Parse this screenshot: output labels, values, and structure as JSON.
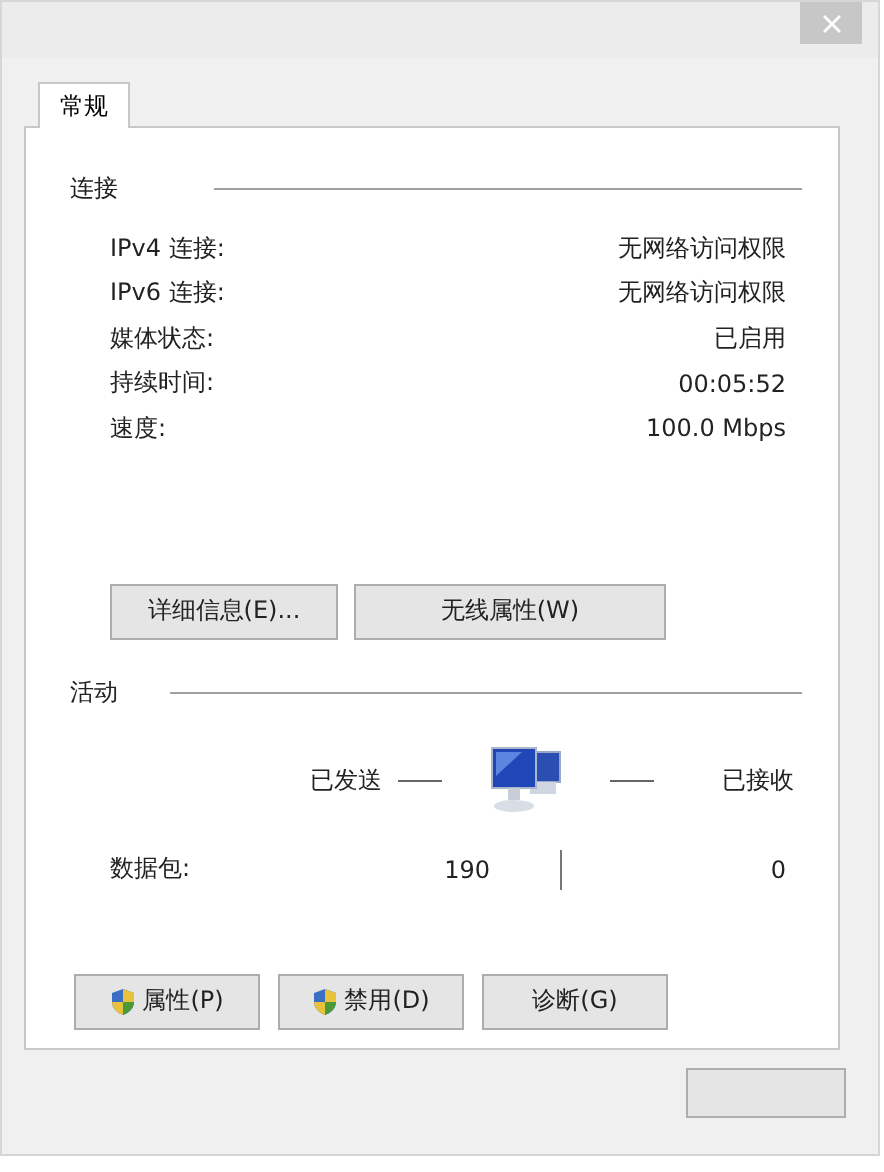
{
  "tabs": [
    {
      "label": "常规",
      "selected": true
    }
  ],
  "connection": {
    "title": "连接",
    "rows": [
      {
        "label": "IPv4 连接:",
        "value": "无网络访问权限"
      },
      {
        "label": "IPv6 连接:",
        "value": "无网络访问权限"
      },
      {
        "label": "媒体状态:",
        "value": "已启用"
      },
      {
        "label": "持续时间:",
        "value": "00:05:52"
      },
      {
        "label": "速度:",
        "value": "100.0 Mbps"
      }
    ]
  },
  "connection_buttons": [
    "详细信息(E)...",
    "无线属性(W)"
  ],
  "activity": {
    "title": "活动",
    "sent_label": "已发送",
    "received_label": "已接收",
    "packets_label": "数据包:",
    "sent": "190",
    "received": "0"
  },
  "bottom_buttons": [
    {
      "label": "属性(P)",
      "shield": true
    },
    {
      "label": "禁用(D)",
      "shield": true
    },
    {
      "label": "诊断(G)",
      "shield": false
    }
  ]
}
